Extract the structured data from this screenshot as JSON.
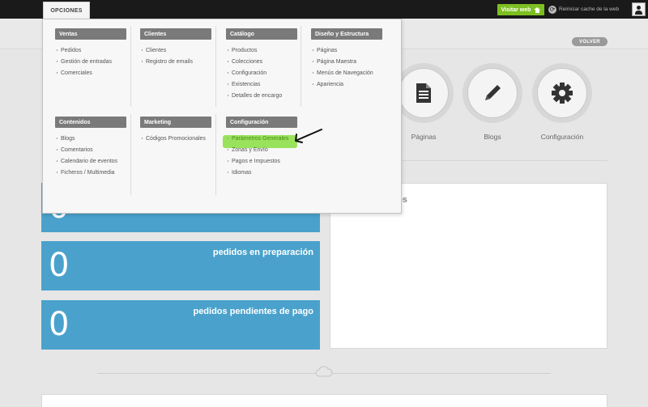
{
  "topbar": {
    "opciones": "OPCIONES",
    "visit_web": "Visitar web",
    "reset_cache": "Reiniciar cache de la web"
  },
  "header": {
    "volver": "VOLVER"
  },
  "shortcuts": [
    {
      "label": "Páginas",
      "icon": "document-icon"
    },
    {
      "label": "Blogs",
      "icon": "pencil-icon"
    },
    {
      "label": "Configuración",
      "icon": "gear-icon"
    }
  ],
  "stats": [
    {
      "value": "0",
      "label": ""
    },
    {
      "value": "0",
      "label": "pedidos en preparación"
    },
    {
      "value": "0",
      "label": "pedidos pendientes de pago"
    }
  ],
  "panel": {
    "title": "os"
  },
  "menu": {
    "ventas": {
      "title": "Ventas",
      "items": [
        "Pedidos",
        "Gestión de entradas",
        "Comerciales"
      ]
    },
    "clientes": {
      "title": "Clientes",
      "items": [
        "Clientes",
        "Registro de emails"
      ]
    },
    "catalogo": {
      "title": "Catálogo",
      "items": [
        "Productos",
        "Colecciones",
        "Configuración",
        "Existencias",
        "Detalles de encargo"
      ]
    },
    "diseno": {
      "title": "Diseño y Estructura",
      "items": [
        "Páginas",
        "Página Maestra",
        "Menús de Navegación",
        "Apariencia"
      ]
    },
    "contenidos": {
      "title": "Contenidos",
      "items": [
        "Blogs",
        "Comentarios",
        "Calendario de eventos",
        "Ficheros / Multimedia"
      ]
    },
    "marketing": {
      "title": "Marketing",
      "items": [
        "Códigos Promocionales"
      ]
    },
    "configuracion": {
      "title": "Configuración",
      "items": [
        "Parámetros Generales",
        "Zonas y Envío",
        "Pagos e Impuestos",
        "Idiomas"
      ]
    }
  },
  "colors": {
    "accent_green": "#7cbf21",
    "stat_blue": "#4aa2cc",
    "highlight": "#8ee04a"
  }
}
